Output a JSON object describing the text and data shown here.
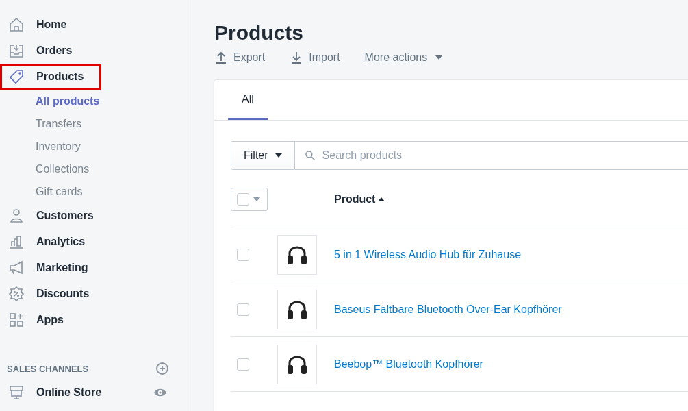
{
  "sidebar": {
    "items": [
      {
        "label": "Home",
        "selected": false,
        "highlighted": false
      },
      {
        "label": "Orders",
        "selected": false,
        "highlighted": false
      },
      {
        "label": "Products",
        "selected": true,
        "highlighted": true,
        "children": [
          {
            "label": "All products",
            "selected": true
          },
          {
            "label": "Transfers",
            "selected": false
          },
          {
            "label": "Inventory",
            "selected": false
          },
          {
            "label": "Collections",
            "selected": false
          },
          {
            "label": "Gift cards",
            "selected": false
          }
        ]
      },
      {
        "label": "Customers",
        "selected": false,
        "highlighted": false
      },
      {
        "label": "Analytics",
        "selected": false,
        "highlighted": false
      },
      {
        "label": "Marketing",
        "selected": false,
        "highlighted": false
      },
      {
        "label": "Discounts",
        "selected": false,
        "highlighted": false
      },
      {
        "label": "Apps",
        "selected": false,
        "highlighted": false
      }
    ],
    "sales_channels": {
      "heading": "SALES CHANNELS",
      "items": [
        {
          "label": "Online Store"
        }
      ]
    }
  },
  "page": {
    "title": "Products",
    "actions": [
      {
        "label": "Export",
        "kind": "export"
      },
      {
        "label": "Import",
        "kind": "import"
      },
      {
        "label": "More actions",
        "kind": "menu"
      }
    ]
  },
  "card": {
    "tabs": [
      {
        "label": "All",
        "selected": true
      }
    ],
    "filter": {
      "label": "Filter"
    },
    "search": {
      "placeholder": "Search products"
    },
    "table": {
      "columns": [
        {
          "label": "Product",
          "sorted_ascending": true
        }
      ],
      "rows": [
        {
          "name": "5 in 1 Wireless Audio Hub für Zuhause",
          "checked": false
        },
        {
          "name": "Baseus Faltbare Bluetooth Over-Ear Kopfhörer",
          "checked": false
        },
        {
          "name": "Beebop™ Bluetooth Kopfhörer",
          "checked": false
        }
      ]
    }
  }
}
